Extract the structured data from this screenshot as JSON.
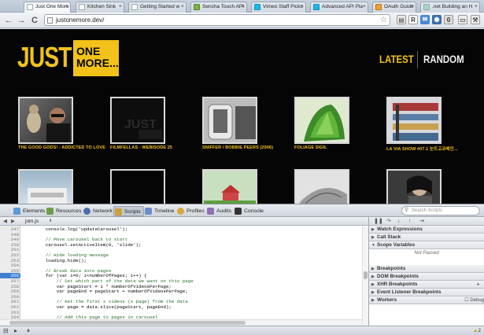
{
  "tabs": [
    {
      "label": "Just One More",
      "active": true
    },
    {
      "label": "Kitchen Sink"
    },
    {
      "label": "Getting Started w"
    },
    {
      "label": "Sencha Touch API"
    },
    {
      "label": "Vimeo Staff Picks"
    },
    {
      "label": "Advanced API Pla"
    },
    {
      "label": "OAuth Guide"
    },
    {
      "label": ".net Building an H"
    }
  ],
  "toolbar": {
    "back": "←",
    "forward": "→",
    "reload": "C",
    "url": "justonemore.dev/",
    "star": "☆",
    "extensions": [
      "R",
      "✉",
      "◉",
      "0"
    ]
  },
  "site": {
    "logo_just": "JUST",
    "logo_one": "ONE",
    "logo_more": "MORE...",
    "nav_latest": "LATEST",
    "nav_random": "RANDOM",
    "videos": [
      {
        "title": "THE GOOD GODS! - ADDICTED TO LOVE"
      },
      {
        "title": "FILMFELLAS - WEBISODE 25"
      },
      {
        "title": "SNIFFER / BOBBIE PEERS (2006)"
      },
      {
        "title": "FOLIAGE SIGIL"
      },
      {
        "title": "LA VIA SHOW #07.1 눈뜨고코베인..."
      },
      {
        "title": ""
      },
      {
        "title": ""
      },
      {
        "title": ""
      },
      {
        "title": ""
      },
      {
        "title": ""
      }
    ]
  },
  "devtools": {
    "tabs": [
      "Elements",
      "Resources",
      "Network",
      "Scripts",
      "Timeline",
      "Profiles",
      "Audits",
      "Console"
    ],
    "active_tab": "Scripts",
    "search_placeholder": "Search Scripts",
    "file": "jom.js",
    "lines": [
      {
        "n": "247",
        "code": "        console.log('updateCarousel');"
      },
      {
        "n": "248",
        "code": ""
      },
      {
        "n": "249",
        "code": "        // Move carousel back to start"
      },
      {
        "n": "250",
        "code": "        carousel.setActiveItem(0, 'slide');"
      },
      {
        "n": "251",
        "code": ""
      },
      {
        "n": "252",
        "code": "        // Hide loading message"
      },
      {
        "n": "253",
        "code": "        loading.hide();"
      },
      {
        "n": "254",
        "code": ""
      },
      {
        "n": "255",
        "code": "        // Break data into pages"
      },
      {
        "n": "256",
        "code": "        for (var i=0; i<numberOfPages; i++) {"
      },
      {
        "n": "257",
        "code": "            // Set which part of the data we want on this page"
      },
      {
        "n": "258",
        "code": "            var pageStart = i * numberOfVideosPerPage;"
      },
      {
        "n": "259",
        "code": "            var pageEnd = pageStart + numberOfVideosPerPage;"
      },
      {
        "n": "260",
        "code": ""
      },
      {
        "n": "261",
        "code": "            // Get the first x videos (x page) from the data"
      },
      {
        "n": "262",
        "code": "            var page = data.slice(pageStart, pageEnd);"
      },
      {
        "n": "263",
        "code": ""
      },
      {
        "n": "264",
        "code": "            // Add this page to pages in carousel"
      },
      {
        "n": "265",
        "code": "            pages[i].update(page);"
      }
    ],
    "breakpoint_line": "256",
    "panes": {
      "watch": "Watch Expressions",
      "callstack": "Call Stack",
      "scope": "Scope Variables",
      "not_paused": "Not Paused",
      "breakpoints": "Breakpoints",
      "dom_breakpoints": "DOM Breakpoints",
      "xhr_breakpoints": "XHR Breakpoints",
      "event_breakpoints": "Event Listener Breakpoints",
      "workers": "Workers",
      "debug_label": "Debug"
    },
    "warnings": "2"
  },
  "colors": {
    "brand_yellow": "#f2c21a",
    "breakpoint_blue": "#3f7fd0"
  }
}
